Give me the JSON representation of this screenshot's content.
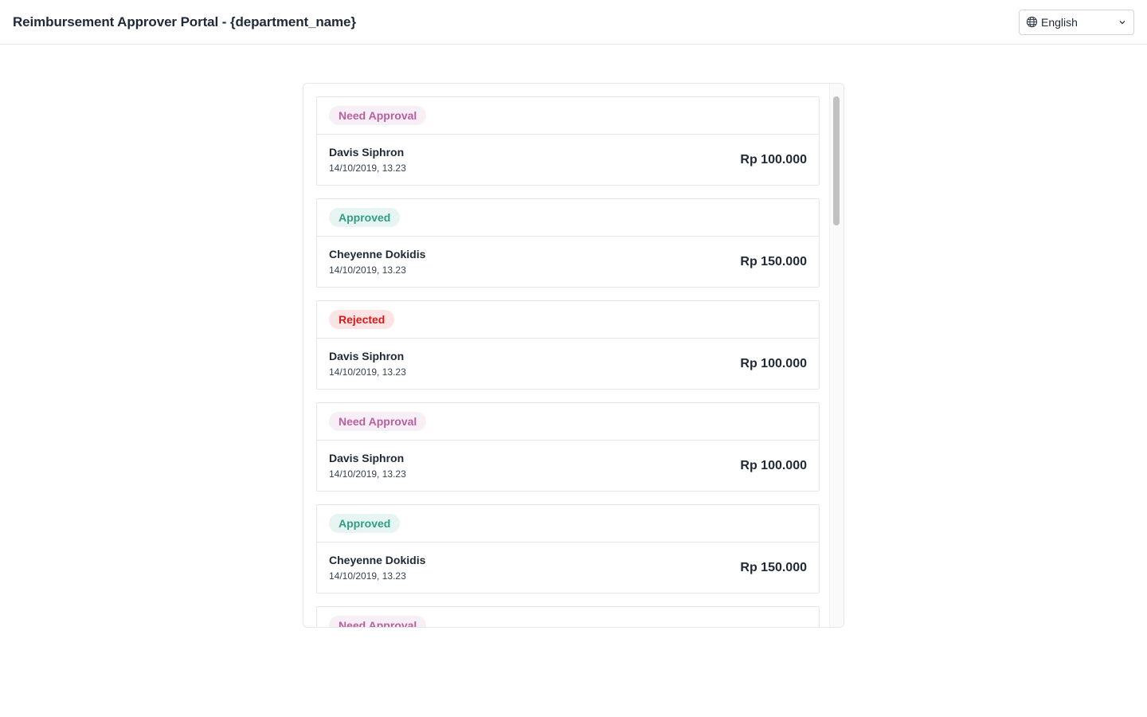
{
  "header": {
    "title": "Reimbursement Approver Portal - {department_name}",
    "language": {
      "selected": "English",
      "icon": "globe-icon"
    }
  },
  "colors": {
    "need_approval_bg": "#f8eef6",
    "need_approval_fg": "#b7609f",
    "approved_bg": "#e6f5f1",
    "approved_fg": "#2f9e85",
    "rejected_bg": "#fde4e4",
    "rejected_fg": "#d31b1b"
  },
  "requests": [
    {
      "status": "Need Approval",
      "status_key": "pending",
      "name": "Davis Siphron",
      "datetime": "14/10/2019, 13.23",
      "amount": "Rp 100.000"
    },
    {
      "status": "Approved",
      "status_key": "approved",
      "name": "Cheyenne Dokidis",
      "datetime": "14/10/2019, 13.23",
      "amount": "Rp 150.000"
    },
    {
      "status": "Rejected",
      "status_key": "rejected",
      "name": "Davis Siphron",
      "datetime": "14/10/2019, 13.23",
      "amount": "Rp 100.000"
    },
    {
      "status": "Need Approval",
      "status_key": "pending",
      "name": "Davis Siphron",
      "datetime": "14/10/2019, 13.23",
      "amount": "Rp 100.000"
    },
    {
      "status": "Approved",
      "status_key": "approved",
      "name": "Cheyenne Dokidis",
      "datetime": "14/10/2019, 13.23",
      "amount": "Rp 150.000"
    },
    {
      "status": "Need Approval",
      "status_key": "pending",
      "name": "",
      "datetime": "",
      "amount": ""
    }
  ]
}
